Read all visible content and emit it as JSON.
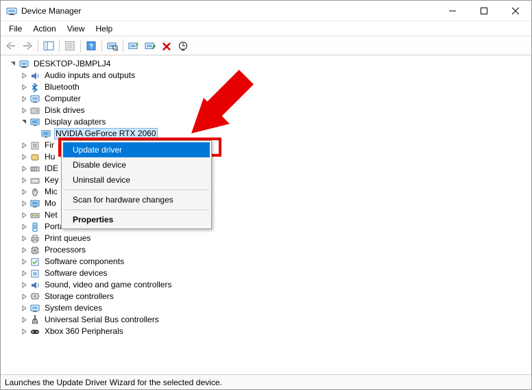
{
  "window": {
    "title": "Device Manager"
  },
  "menubar": [
    "File",
    "Action",
    "View",
    "Help"
  ],
  "tree": {
    "root": "DESKTOP-JBMPLJ4",
    "nodes": [
      {
        "label": "Audio inputs and outputs",
        "icon": "audio"
      },
      {
        "label": "Bluetooth",
        "icon": "bluetooth"
      },
      {
        "label": "Computer",
        "icon": "computer"
      },
      {
        "label": "Disk drives",
        "icon": "disk"
      },
      {
        "label": "Display adapters",
        "icon": "display",
        "expanded": true,
        "children": [
          {
            "label": "NVIDIA GeForce RTX 2060",
            "icon": "display",
            "selected": true
          }
        ]
      },
      {
        "label": "Fir",
        "icon": "firmware",
        "cut": true
      },
      {
        "label": "Hu",
        "icon": "hid",
        "cut": true
      },
      {
        "label": "IDE",
        "icon": "ide",
        "cut": true
      },
      {
        "label": "Key",
        "icon": "keyboard",
        "cut": true
      },
      {
        "label": "Mic",
        "icon": "mouse",
        "cut": true
      },
      {
        "label": "Mo",
        "icon": "monitor",
        "cut": true
      },
      {
        "label": "Net",
        "icon": "network",
        "cut": true
      },
      {
        "label": "Portable Devices",
        "icon": "portable"
      },
      {
        "label": "Print queues",
        "icon": "printer"
      },
      {
        "label": "Processors",
        "icon": "cpu"
      },
      {
        "label": "Software components",
        "icon": "swcomp"
      },
      {
        "label": "Software devices",
        "icon": "swdev"
      },
      {
        "label": "Sound, video and game controllers",
        "icon": "sound"
      },
      {
        "label": "Storage controllers",
        "icon": "storage"
      },
      {
        "label": "System devices",
        "icon": "system"
      },
      {
        "label": "Universal Serial Bus controllers",
        "icon": "usb"
      },
      {
        "label": "Xbox 360 Peripherals",
        "icon": "xbox"
      }
    ]
  },
  "context_menu": {
    "items": [
      {
        "label": "Update driver",
        "highlight": true
      },
      {
        "label": "Disable device"
      },
      {
        "label": "Uninstall device"
      },
      {
        "sep": true
      },
      {
        "label": "Scan for hardware changes"
      },
      {
        "sep": true
      },
      {
        "label": "Properties",
        "bold": true
      }
    ]
  },
  "statusbar": "Launches the Update Driver Wizard for the selected device."
}
